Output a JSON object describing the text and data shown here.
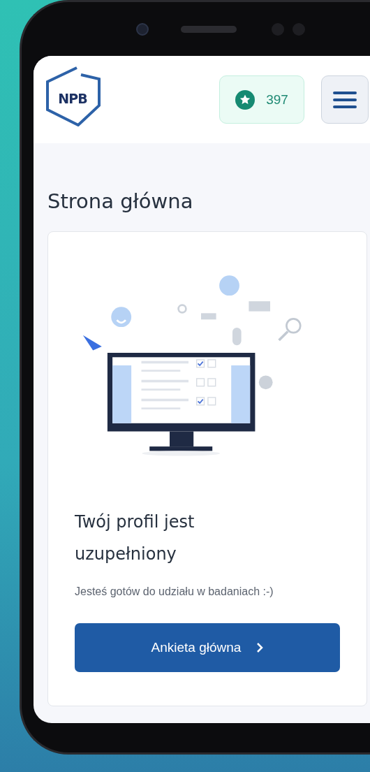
{
  "header": {
    "logo_text": "NPB",
    "points": "397"
  },
  "page_title": "Strona główna",
  "card": {
    "title": "Twój profil jest uzupełniony",
    "subtitle": "Jesteś gotów do udziału w badaniach :-)",
    "button": "Ankieta główna"
  }
}
